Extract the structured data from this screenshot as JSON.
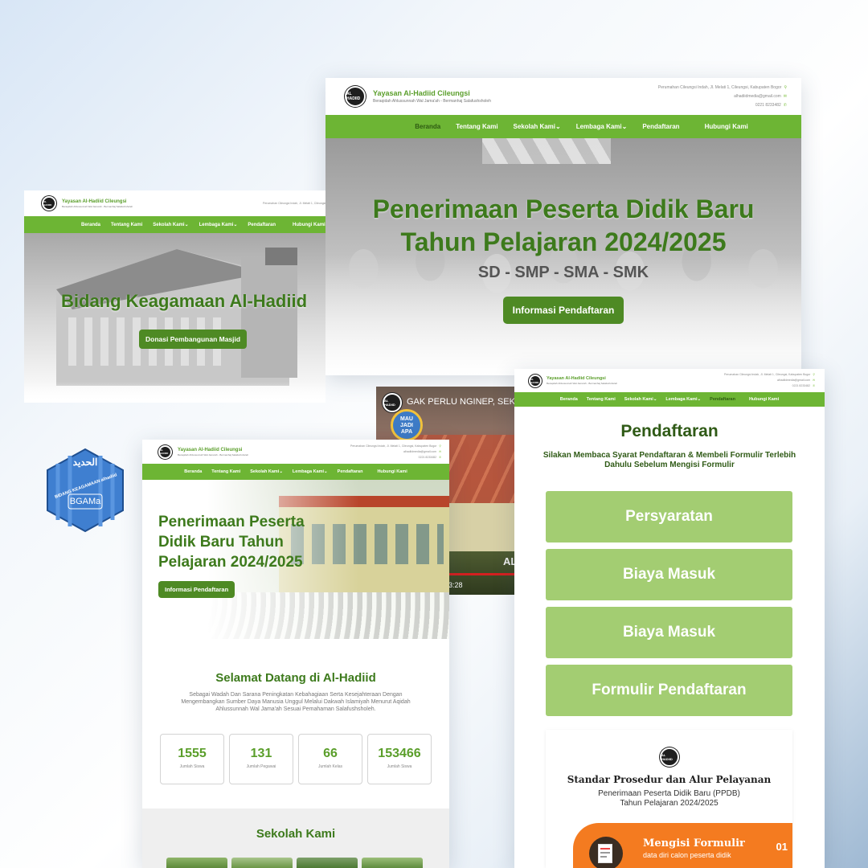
{
  "site": {
    "brand": "Yayasan Al-Hadiid Cileungsi",
    "tagline": "Beraqidah Ahlussunnah Wal Jama'ah - Bermanhaj Salafushsholeh",
    "logo_text": "AL HADIID",
    "address": "Perumahan Cileungsi Indah, Jl. Melati 1, Cileungsi, Kabupaten Bogor",
    "email": "alhadiidmedia@gmail.com",
    "phone": "0221 8233482",
    "nav": [
      "Beranda",
      "Tentang Kami",
      "Sekolah Kami",
      "Lembaga Kami",
      "Pendaftaran",
      "Hubungi Kami"
    ],
    "dropdown_mark": "⌄"
  },
  "colors": {
    "brand_green": "#6db534",
    "dark_green": "#3d7a1c",
    "button_green": "#4e8a24",
    "light_green": "#a3cd72",
    "orange": "#f47b20"
  },
  "main_hero": {
    "title_line1": "Penerimaan Peserta Didik Baru",
    "title_line2": "Tahun Pelajaran 2024/2025",
    "levels": "SD - SMP - SMA - SMK",
    "button": "Informasi Pendaftaran"
  },
  "keagamaan": {
    "title": "Bidang Keagamaan Al-Hadiid",
    "button": "Donasi Pembangunan Masjid"
  },
  "bgama_badge": {
    "arabic": "الحديد",
    "arc": "BIDANG KEAGAMAAN alhadiid",
    "label": "BGAMa"
  },
  "video": {
    "caption": "GAK PERLU NGINEP, SEKO",
    "badge_line1": "MAU",
    "badge_line2": "JADI",
    "badge_line3": "APA",
    "overlay": "AL",
    "time": "3:28"
  },
  "home": {
    "hero_title": "Penerimaan Peserta Didik Baru Tahun Pelajaran 2024/2025",
    "hero_button": "Informasi Pendaftaran",
    "welcome_title": "Selamat Datang di Al-Hadiid",
    "welcome_text": "Sebagai Wadah Dan Sarana Peningkatan Kebahagiaan Serta Kesejahteraan Dengan Mengembangkan Sumber Daya Manusia Unggul Melalui Dakwah Islamiyah Menurut Aqidah Ahlussunnah Wal Jama'ah Sesuai Pemahaman Salafushsholeh.",
    "stats": [
      {
        "value": "1555",
        "label": "Jumlah Siswa"
      },
      {
        "value": "131",
        "label": "Jumlah Pegawai"
      },
      {
        "value": "66",
        "label": "Jumlah Kelas"
      },
      {
        "value": "153466",
        "label": "Jumlah Siswa"
      }
    ],
    "schools_title": "Sekolah Kami"
  },
  "pendaftaran": {
    "title": "Pendaftaran",
    "subtitle": "Silakan Membaca Syarat Pendaftaran & Membeli Formulir Terlebih Dahulu Sebelum Mengisi Formulir",
    "buttons": [
      "Persyaratan",
      "Biaya Masuk",
      "Biaya Masuk",
      "Formulir Pendaftaran"
    ],
    "sop_title": "Standar Prosedur dan Alur Pelayanan",
    "sop_line1": "Penerimaan Peserta Didik Baru (PPDB)",
    "sop_line2": "Tahun Pelajaran 2024/2025",
    "step_title": "Mengisi Formulir",
    "step_sub": "data diri calon peserta didik",
    "step_num": "01"
  }
}
